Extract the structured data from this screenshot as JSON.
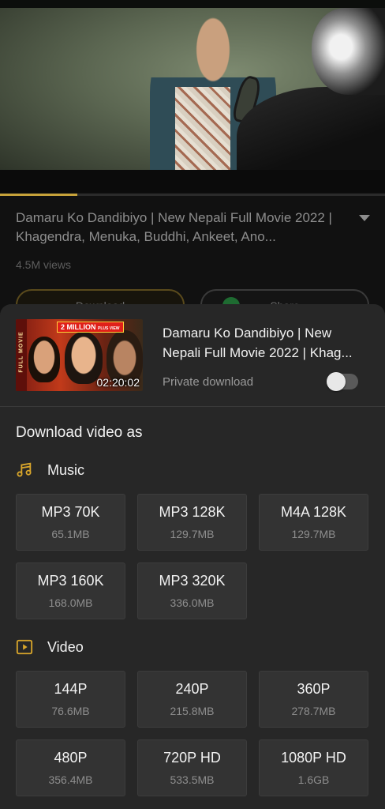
{
  "background": {
    "video_title": "Damaru Ko Dandibiyo | New Nepali Full Movie 2022 | Khagendra, Menuka, Buddhi, Ankeet, Ano...",
    "views": "4.5M views",
    "download_button_label": "Download",
    "share_button_label": "Share",
    "playback_progress": 0.2
  },
  "sheet": {
    "thumbnail": {
      "side_text": "FULL MOVIE",
      "badge_text": "2 MILLION",
      "badge_sub": "PLUS VIEW",
      "duration": "02:20:02"
    },
    "title": "Damaru Ko Dandibiyo | New Nepali Full Movie 2022 | Khag...",
    "private_download_label": "Private download",
    "private_download_enabled": false,
    "heading": "Download video as",
    "music": {
      "label": "Music",
      "icon": "music-note-icon",
      "options": [
        {
          "format": "MP3 70K",
          "size": "65.1MB"
        },
        {
          "format": "MP3 128K",
          "size": "129.7MB"
        },
        {
          "format": "M4A 128K",
          "size": "129.7MB"
        },
        {
          "format": "MP3 160K",
          "size": "168.0MB"
        },
        {
          "format": "MP3 320K",
          "size": "336.0MB"
        }
      ]
    },
    "video": {
      "label": "Video",
      "icon": "play-square-icon",
      "options": [
        {
          "format": "144P",
          "size": "76.6MB"
        },
        {
          "format": "240P",
          "size": "215.8MB"
        },
        {
          "format": "360P",
          "size": "278.7MB"
        },
        {
          "format": "480P",
          "size": "356.4MB"
        },
        {
          "format": "720P HD",
          "size": "533.5MB"
        },
        {
          "format": "1080P HD",
          "size": "1.6GB"
        }
      ]
    }
  },
  "colors": {
    "accent": "#c7a23a",
    "sheet_background": "#272727",
    "option_background": "#333333"
  }
}
